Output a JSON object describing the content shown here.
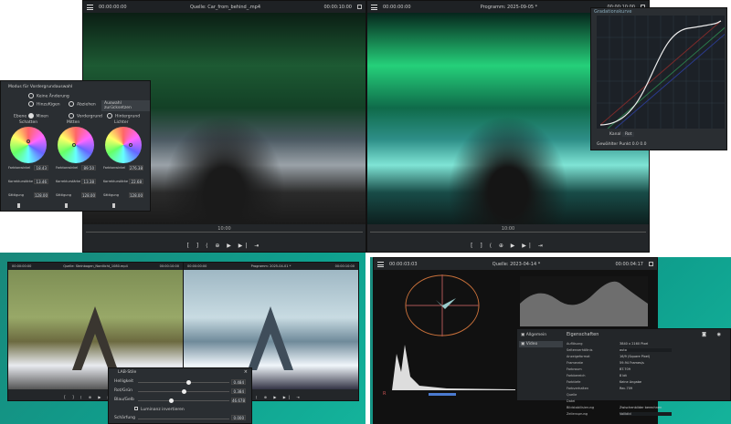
{
  "source_monitor": {
    "timecode_start": "00:00:00:00",
    "title": "Quelle: Car_from_behind_.mp4",
    "timecode_end": "00:00:10:00",
    "ruler_label": "10:00"
  },
  "program_monitor": {
    "timecode_start": "00:00:00:00",
    "title": "Programm: 2025-09-05 *",
    "timecode_end": "00:00:10:00",
    "ruler_label": "10:00"
  },
  "transport_controls": "[ ] ⟨ ⊕ ▶ ▶| ⇥",
  "color_panel": {
    "mode_title": "Modus für Vordergrundauswahl",
    "options": [
      "Keine Änderung",
      "Hinzufügen",
      "Abziehen"
    ],
    "reset_button": "Auswahl zurücksetzen",
    "range_label": "Ebene",
    "ranges": [
      "Mixen",
      "Vordergrund",
      "Hintergrund"
    ],
    "wheels": [
      {
        "title": "Schatten",
        "hue_label": "Farbtonwinkel",
        "hue": "18.43",
        "strength_label": "Korrekturstärke",
        "strength": "13.46",
        "sat_label": "Sättigung",
        "sat": "128.00"
      },
      {
        "title": "Mitten",
        "hue_label": "Farbtonwinkel",
        "hue": "89.50",
        "strength_label": "Korrekturstärke",
        "strength": "13.38",
        "sat_label": "Sättigung",
        "sat": "128.00"
      },
      {
        "title": "Lichter",
        "hue_label": "Farbtonwinkel",
        "hue": "276.38",
        "strength_label": "Korrekturstärke",
        "strength": "22.68",
        "sat_label": "Sättigung",
        "sat": "128.00"
      }
    ]
  },
  "curves_panel": {
    "title": "Gradationskurve",
    "channel_label": "Kanal",
    "channel": "Rot",
    "point_label": "Gewählter Punkt",
    "x": "0.0",
    "y": "0.0"
  },
  "bottom_left": {
    "source_title": "Quelle: Steinbogen_Nordlicht_1080.mp4",
    "source_tc": "00:00:00:00",
    "source_tc_end": "00:00:10:00",
    "program_title": "Programm: 2025-04-01 *",
    "program_tc": "00:00:00:00",
    "program_tc_end": "00:00:10:00"
  },
  "lab_dialog": {
    "title": "LAB-Stile",
    "rows": [
      {
        "label": "Helligkeit",
        "value": "0.484"
      },
      {
        "label": "Rot/Grün",
        "value": "0.384"
      },
      {
        "label": "Blau/Gelb",
        "value": "46.678"
      }
    ],
    "checkbox": "Luminanz invertieren",
    "last": {
      "label": "Schärfung",
      "value": "0.000"
    }
  },
  "scopes_window": {
    "timecode_start": "00:00:03:03",
    "title": "Quelle: 2023-04-14 *",
    "timecode_end": "00:00:04:17",
    "scope_label_1": "R",
    "props": {
      "tabs": [
        "Allgemein",
        "Video"
      ],
      "header": "Eigenschaften",
      "rows": [
        [
          "Auflösung",
          "3840 x 2160 Pixel"
        ],
        [
          "Seitenverhältnis",
          "auto"
        ],
        [
          "Anzeigeformat",
          "16/9 (Square Pixel)"
        ],
        [
          "Framerate",
          "59.94 Frames/s"
        ],
        [
          "Farbraum",
          "BT.709"
        ],
        [
          "Farbbereich",
          "8 bit"
        ],
        [
          "Farbtiefe",
          "Keine Angabe"
        ],
        [
          "Farbverhalten",
          "Rec.709"
        ],
        [
          "Quelle",
          ""
        ],
        [
          "Datei",
          ""
        ],
        [
          "Bildstabilisierung",
          "Zwischenbilder berechnen"
        ],
        [
          "Zeilensprung",
          "Vollbild"
        ]
      ]
    }
  }
}
